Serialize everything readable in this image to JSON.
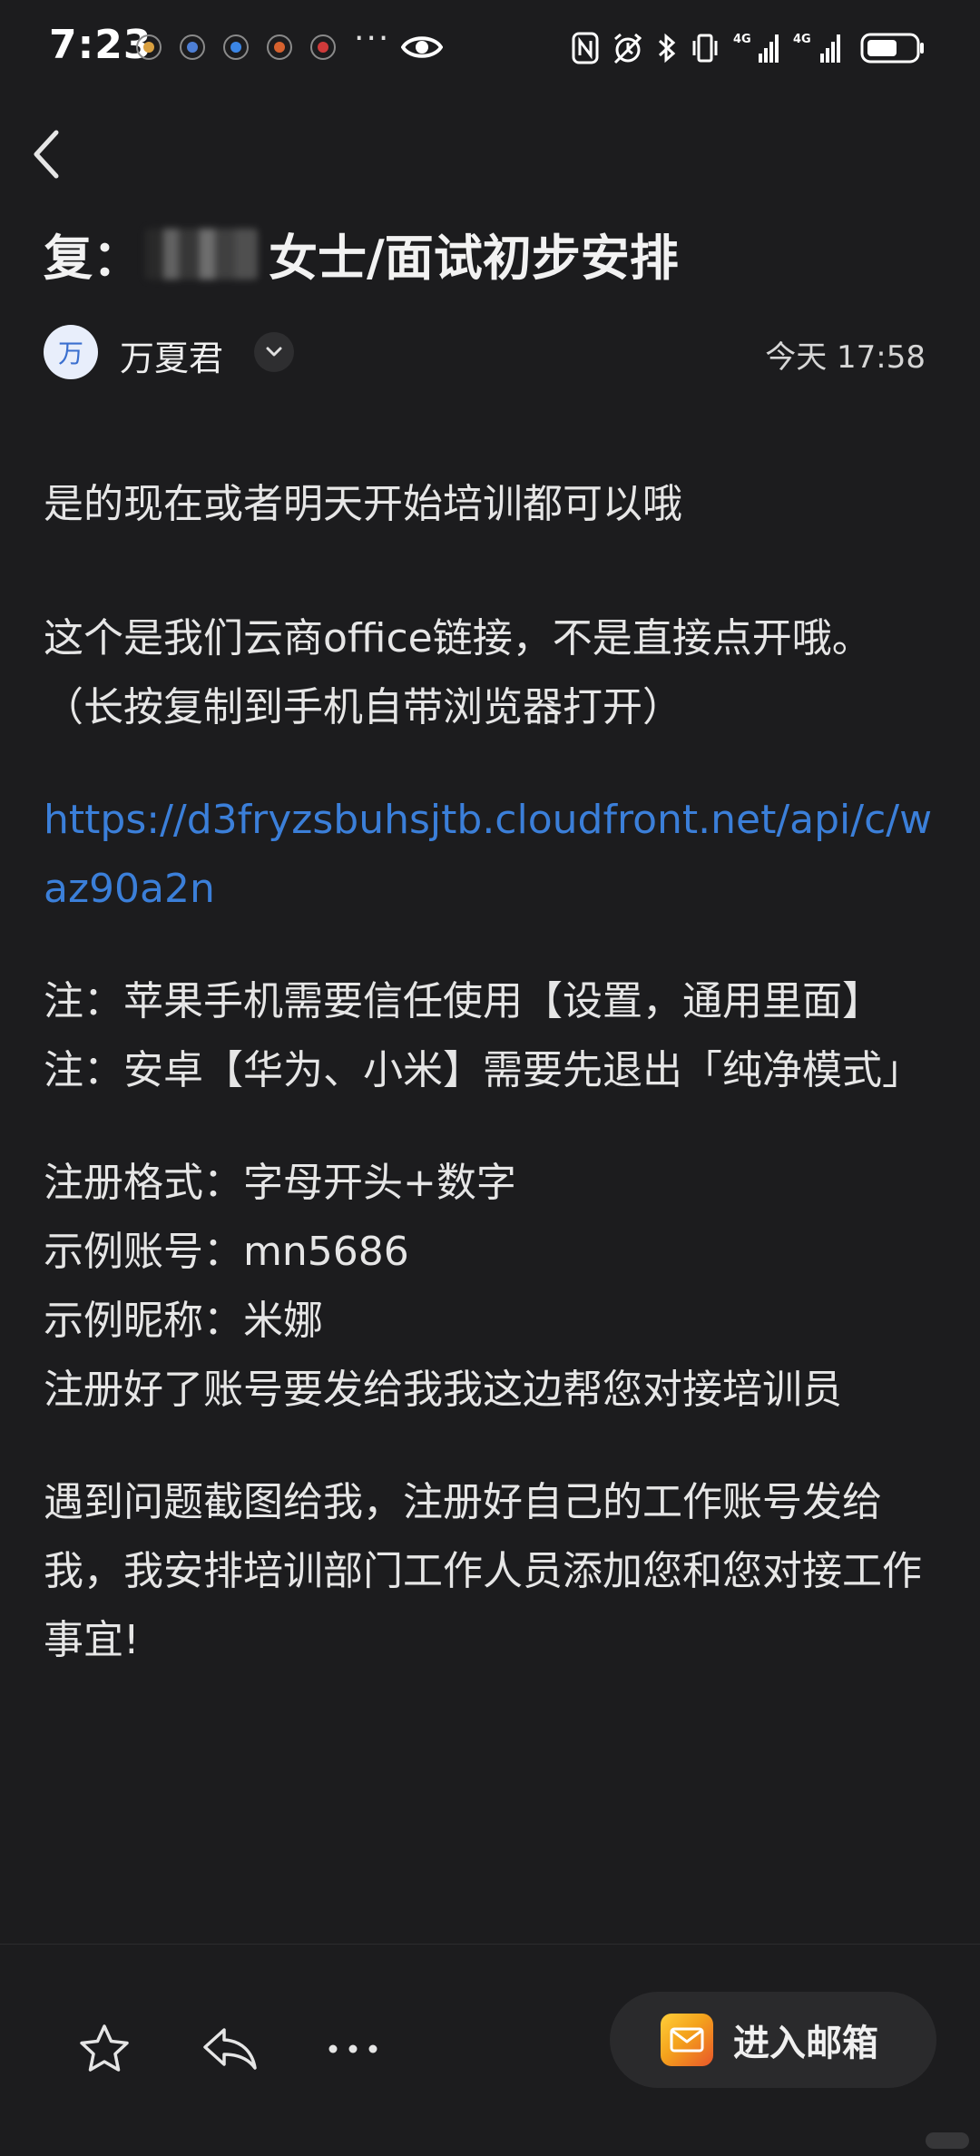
{
  "status_bar": {
    "time": "7:23",
    "notification_icons": [
      "weibo-icon",
      "app-icon",
      "app-icon",
      "app-icon",
      "app-icon"
    ],
    "more": "···",
    "network_1": "4G",
    "network_2": "4G"
  },
  "mail": {
    "subject_prefix": "复：",
    "subject_suffix": "女士/面试初步安排",
    "sender": {
      "avatar_text": "万",
      "name": "万夏君",
      "time": "今天 17:58"
    },
    "body": {
      "line1": "是的现在或者明天开始培训都可以哦",
      "line2": "这个是我们云商office链接，不是直接点开哦。",
      "line3": "（长按复制到手机自带浏览器打开）",
      "link": "https://d3fryzsbuhsjtb.cloudfront.net/api/c/waz90a2n",
      "note1": "注：苹果手机需要信任使用【设置，通用里面】",
      "note2": "注：安卓【华为、小米】需要先退出「纯净模式」",
      "format": "注册格式：字母开头+数字",
      "example_account": "示例账号：mn5686",
      "example_nickname": "示例昵称：米娜",
      "send_instruction": "注册好了账号要发给我我这边帮您对接培训员",
      "problem": "遇到问题截图给我，注册好自己的工作账号发给我，我安排培训部门工作人员添加您和您对接工作事宜!"
    }
  },
  "toolbar": {
    "enter_mailbox_label": "进入邮箱"
  },
  "colors": {
    "background": "#1c1c1e",
    "link": "#3b7fd9",
    "mailbox_accent": "#f4a21c"
  }
}
